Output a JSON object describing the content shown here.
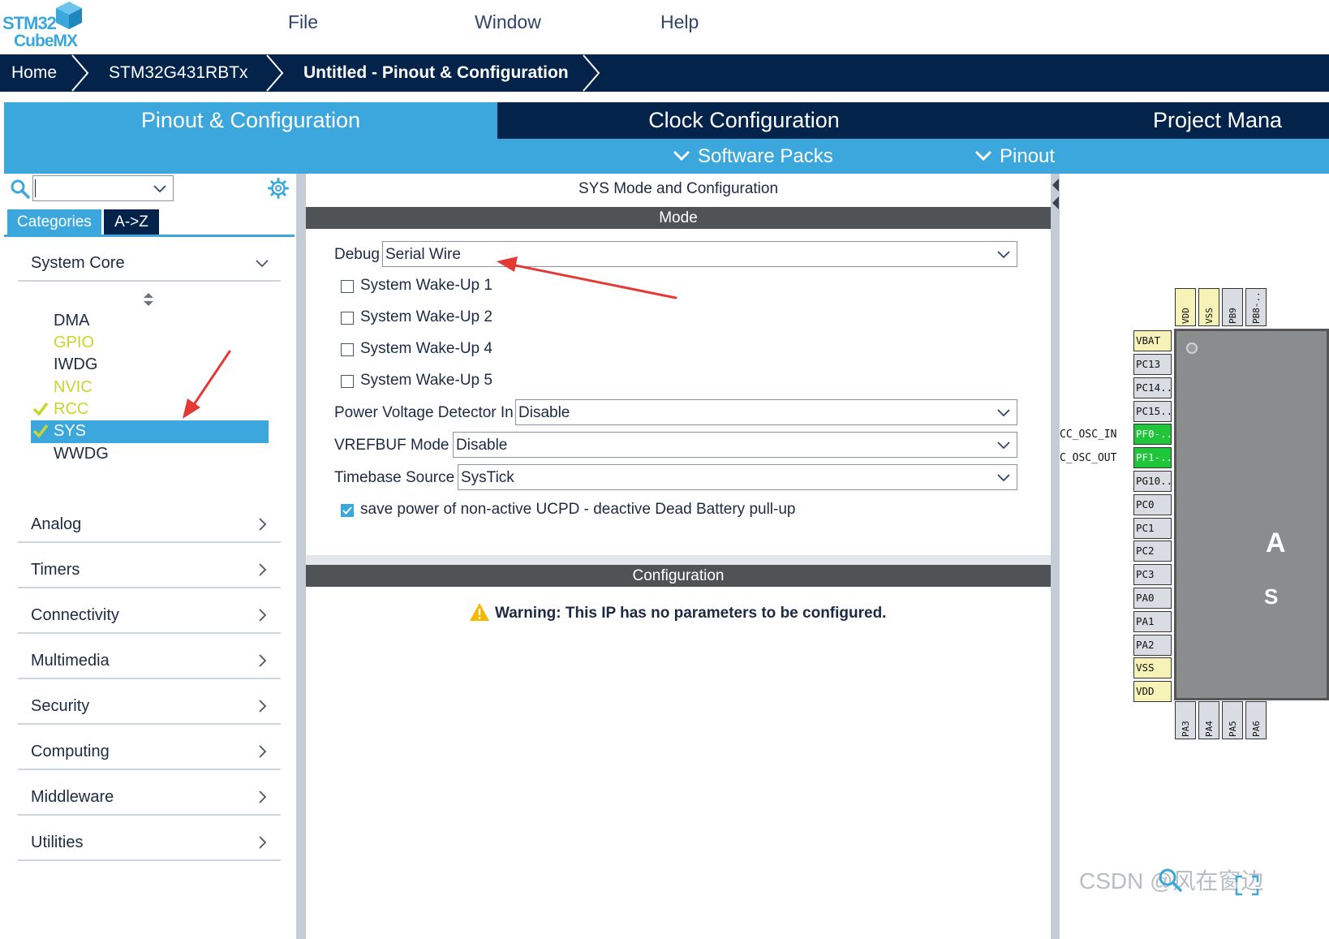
{
  "app": {
    "logo": {
      "line1": "STM32",
      "line2": "CubeMX"
    },
    "menu": [
      "File",
      "Window",
      "Help"
    ]
  },
  "breadcrumb": [
    "Home",
    "STM32G431RBTx",
    "Untitled - Pinout & Configuration"
  ],
  "main_tabs": [
    "Pinout & Configuration",
    "Clock Configuration",
    "Project Mana"
  ],
  "sub_tabs": [
    "Software Packs",
    "Pinout"
  ],
  "left_panel": {
    "search": {
      "value": ""
    },
    "tabs": [
      "Categories",
      "A->Z"
    ],
    "system_core": {
      "label": "System Core",
      "items": [
        {
          "label": "DMA",
          "color": "#1d2a44",
          "checked": false
        },
        {
          "label": "GPIO",
          "color": "#c7d62b",
          "checked": false
        },
        {
          "label": "IWDG",
          "color": "#1d2a44",
          "checked": false
        },
        {
          "label": "NVIC",
          "color": "#c7d62b",
          "checked": false
        },
        {
          "label": "RCC",
          "color": "#c7d62b",
          "checked": true
        },
        {
          "label": "SYS",
          "color": "#ffffff",
          "checked": true,
          "selected": true
        },
        {
          "label": "WWDG",
          "color": "#1d2a44",
          "checked": false
        }
      ]
    },
    "categories": [
      "Analog",
      "Timers",
      "Connectivity",
      "Multimedia",
      "Security",
      "Computing",
      "Middleware",
      "Utilities"
    ]
  },
  "center": {
    "title": "SYS Mode and Configuration",
    "mode_header": "Mode",
    "debug": {
      "label": "Debug",
      "value": "Serial Wire"
    },
    "wakeups": [
      "System Wake-Up 1",
      "System Wake-Up 2",
      "System Wake-Up 4",
      "System Wake-Up 5"
    ],
    "pvd": {
      "label": "Power Voltage Detector In",
      "value": "Disable"
    },
    "vrefbuf": {
      "label": "VREFBUF Mode",
      "value": "Disable"
    },
    "timebase": {
      "label": "Timebase Source",
      "value": "SysTick"
    },
    "ucpd": {
      "label": "save power of non-active UCPD - deactive Dead Battery pull-up",
      "checked": true
    },
    "config_header": "Configuration",
    "warning": "Warning: This IP has no parameters to be configured."
  },
  "chip": {
    "top_pins": [
      "VDD",
      "VSS",
      "PB9",
      "PB8-.."
    ],
    "left_pins": [
      "VBAT",
      "PC13",
      "PC14..",
      "PC15..",
      "PF0-..",
      "PF1-..",
      "PG10..",
      "PC0",
      "PC1",
      "PC2",
      "PC3",
      "PA0",
      "PA1",
      "PA2",
      "VSS",
      "VDD"
    ],
    "bottom_pins": [
      "PA3",
      "PA4",
      "PA5",
      "PA6"
    ],
    "ext_labels": [
      "RCC_OSC_IN",
      "RCC_OSC_OUT"
    ],
    "ext_labels_visible": [
      "CC_OSC_IN",
      "C_OSC_OUT"
    ],
    "body_chars": [
      "A",
      "S"
    ]
  },
  "watermark": "CSDN @风在窗边",
  "colors": {
    "accent": "#3ba7dc",
    "navy": "#03234b",
    "green_pin": "#1fc63a",
    "power_pin": "#f6f2b8"
  }
}
